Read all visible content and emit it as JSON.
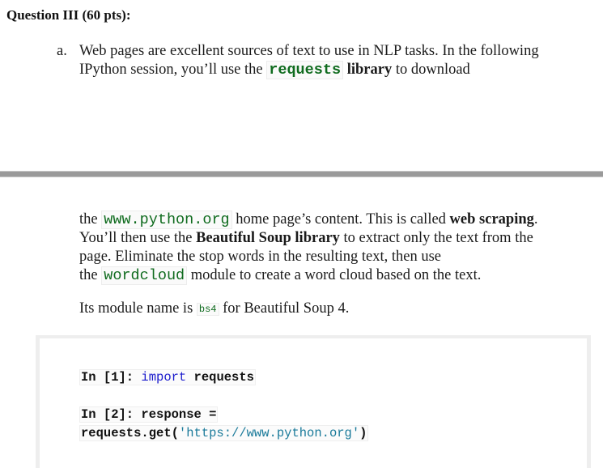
{
  "question": {
    "title": "Question III (60 pts):"
  },
  "item_a": {
    "marker": "a.",
    "para1": {
      "line1": "Web pages are excellent sources of text to use in NLP tasks. In the following",
      "line2_before": "IPython session, you’ll use the ",
      "code_requests": "requests",
      "bold_library": " library",
      "line2_after": " to download"
    },
    "para2": {
      "l1_before": "the ",
      "code_url": "www.python.org",
      "l1_middle": " home page’s content. This is called ",
      "bold_web_scraping": "web scraping",
      "l1_end": ".",
      "l2_before": "You’ll then use the ",
      "bold_bs_library": "Beautiful Soup library",
      "l2_after": " to extract only the text from the",
      "l3": "page. Eliminate the stop words in the resulting text, then use",
      "l4_before": "the ",
      "code_wordcloud": "wordcloud",
      "l4_after": " module to create a word cloud based on the text."
    },
    "para3": {
      "before": "Its module name is ",
      "code_bs4": "bs4",
      "after": " for Beautiful Soup 4."
    }
  },
  "code_block": {
    "line1": {
      "prompt": "In [1]: ",
      "keyword": "import",
      "rest": " requests"
    },
    "line2": {
      "prompt": "In [2]: ",
      "rest": "response ="
    },
    "line3": {
      "call": "requests.get(",
      "string": "'https://www.python.org'",
      "close": ")"
    }
  }
}
